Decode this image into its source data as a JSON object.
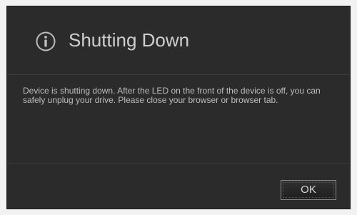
{
  "dialog": {
    "icon": "info-circle-icon",
    "title": "Shutting Down",
    "message": "Device is shutting down. After the LED on the front of the device is off, you can safely unplug your drive. Please close your browser or browser tab.",
    "ok_label": "OK"
  },
  "colors": {
    "dialog_background": "#2b2b2b",
    "title_text": "#cfcfcf",
    "body_text": "#bdbdbd"
  }
}
